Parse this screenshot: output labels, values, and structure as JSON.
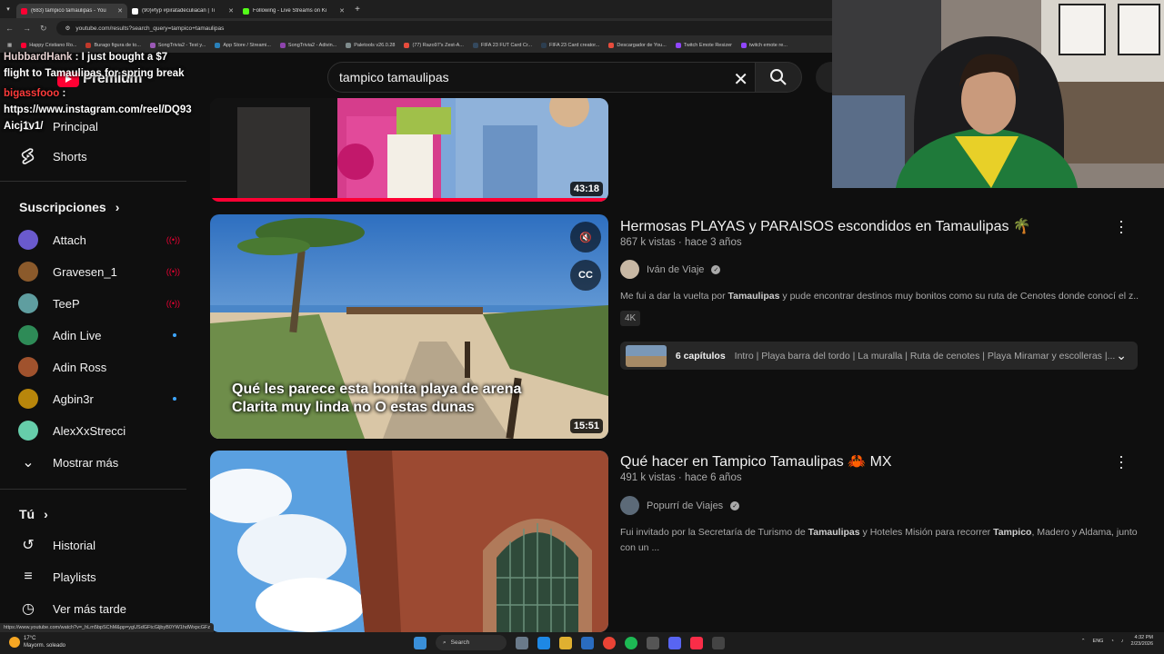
{
  "browser": {
    "tabs": [
      {
        "title": "(683) tampico tamaulipas - You",
        "color": "#ff0033",
        "active": true
      },
      {
        "title": "(90)#fyp #piratadeculiacan | Ti",
        "color": "#ffffff",
        "active": false
      },
      {
        "title": "Following - Live Streams on Ki",
        "color": "#53fc18",
        "active": false
      }
    ],
    "url": "youtube.com/results?search_query=tampico+tamaulipas",
    "bookmarks": [
      {
        "label": "Happy Cristiano Ro...",
        "color": "#ff0033"
      },
      {
        "label": "Burago figura de to...",
        "color": "#c0392b"
      },
      {
        "label": "SongTrivia2 - Test y...",
        "color": "#9b59b6"
      },
      {
        "label": "App Store / Streami...",
        "color": "#2980b9"
      },
      {
        "label": "SongTrivia2 - Adivin...",
        "color": "#8e44ad"
      },
      {
        "label": "Paletools v26.0.28",
        "color": "#7f8c8d"
      },
      {
        "label": "(77) Razo97's Zest-A...",
        "color": "#e74c3c"
      },
      {
        "label": "FIFA 23 FUT Card Cr...",
        "color": "#34495e"
      },
      {
        "label": "FIFA 23 Card creator...",
        "color": "#2c3e50"
      },
      {
        "label": "Descargador de You...",
        "color": "#e74c3c"
      },
      {
        "label": "Twitch Emote Resizer",
        "color": "#9146ff"
      },
      {
        "label": "twitch emote re...",
        "color": "#9146ff"
      }
    ],
    "status_url": "https://www.youtube.com/watch?v=_hLm5bpSChM&pp=ygUSdGFtcGljbyB0YW1hdWxpcGFz"
  },
  "chat": [
    {
      "user": "HubbardHank",
      "text": "I just bought a $7 flight to Tamaulipas for spring break"
    },
    {
      "user": "bigassfooo",
      "text": "https://www.instagram.com/reel/DQ93Aicj1v1/"
    }
  ],
  "sidebar": {
    "logo_text": "Premium",
    "top_items": [
      {
        "label": "Principal",
        "icon": "home-icon"
      },
      {
        "label": "Shorts",
        "icon": "shorts-icon"
      }
    ],
    "subscriptions_title": "Suscripciones",
    "subscriptions": [
      {
        "label": "Attach",
        "status": "live",
        "color": "#6a5acd"
      },
      {
        "label": "Gravesen_1",
        "status": "live",
        "color": "#8b5a2b"
      },
      {
        "label": "TeeP",
        "status": "live",
        "color": "#5f9ea0"
      },
      {
        "label": "Adin Live",
        "status": "new",
        "color": "#2e8b57"
      },
      {
        "label": "Adin Ross",
        "status": "none",
        "color": "#a0522d"
      },
      {
        "label": "Agbin3r",
        "status": "new",
        "color": "#b8860b"
      },
      {
        "label": "AlexXxStrecci",
        "status": "none",
        "color": "#66cdaa"
      }
    ],
    "show_more": "Mostrar más",
    "you_title": "Tú",
    "you_items": [
      {
        "label": "Historial",
        "icon": "history-icon"
      },
      {
        "label": "Playlists",
        "icon": "playlists-icon"
      },
      {
        "label": "Ver más tarde",
        "icon": "watch-later-icon"
      }
    ]
  },
  "search": {
    "query": "tampico tamaulipas"
  },
  "results": [
    {
      "duration": "43:18"
    },
    {
      "title": "Hermosas PLAYAS y PARAISOS escondidos en Tamaulipas 🌴",
      "meta": "867 k vistas · hace 3 años",
      "channel": "Iván de Viaje",
      "desc_pre": "Me fui a dar la vuelta por ",
      "desc_bold": "Tamaulipas",
      "desc_post": " y pude encontrar destinos muy bonitos como su ruta de Cenotes donde conocí el z...",
      "badge": "4K",
      "chapters_count": "6 capítulos",
      "chapters_list": "Intro | Playa barra del tordo | La muralla | Ruta de cenotes | Playa Miramar y escolleras |...",
      "caption": "Qué les parece esta bonita playa de arena Clarita muy linda no O estas dunas",
      "duration": "15:51",
      "cc": "CC"
    },
    {
      "title": "Qué hacer en Tampico Tamaulipas 🦀 MX",
      "meta": "491 k vistas · hace 6 años",
      "channel": "Popurrí de Viajes",
      "desc_a": "Fui invitado por la Secretaría de Turismo de ",
      "desc_b": "Tamaulipas",
      "desc_c": " y Hoteles Misión para recorrer ",
      "desc_d": "Tampico",
      "desc_e": ", Madero y Aldama, junto con un ..."
    }
  ],
  "taskbar": {
    "temp": "17°C",
    "weather": "Mayorm. soleado",
    "search": "Search",
    "lang": "ENG",
    "time": "4:32 PM",
    "date": "2/23/2026"
  }
}
